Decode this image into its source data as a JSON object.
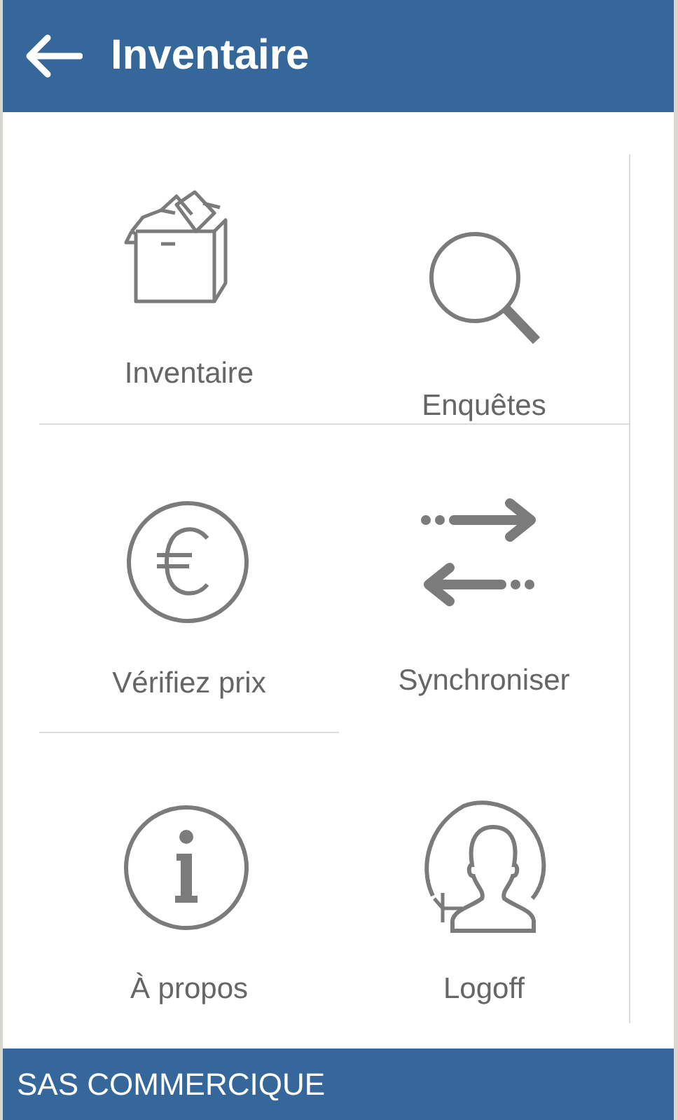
{
  "app_bar": {
    "title": "Inventaire"
  },
  "tiles": [
    {
      "kind": "box",
      "label": "Inventaire"
    },
    {
      "kind": "search",
      "label": "Enquêtes"
    },
    {
      "kind": "euro",
      "label": "Vérifiez prix"
    },
    {
      "kind": "sync",
      "label": "Synchroniser"
    },
    {
      "kind": "info",
      "label": "À propos"
    },
    {
      "kind": "user",
      "label": "Logoff"
    }
  ],
  "footer": {
    "text": "SAS COMMERCIQUE"
  }
}
